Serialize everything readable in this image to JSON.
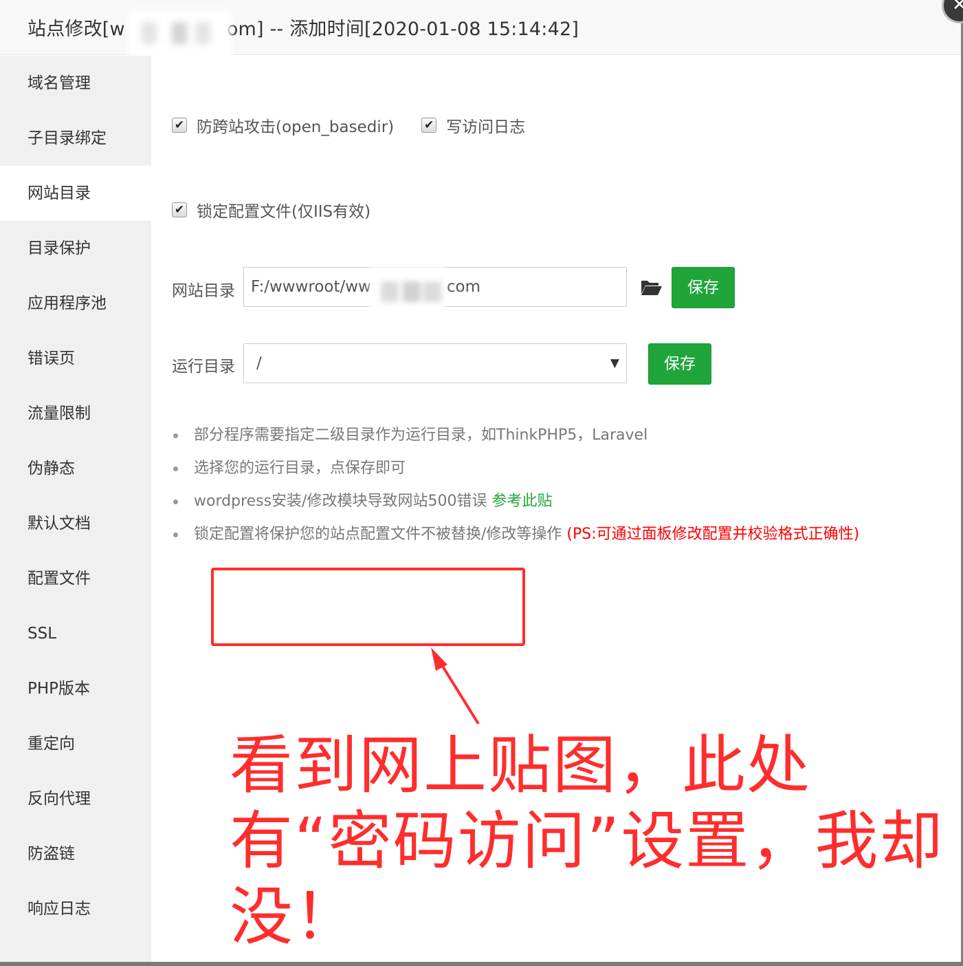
{
  "dialog": {
    "title_prefix": "站点修改[w",
    "title_suffix": "om] -- 添加时间[2020-01-08 15:14:42]",
    "close_icon": "close-icon"
  },
  "sidebar": {
    "items": [
      {
        "label": "域名管理"
      },
      {
        "label": "子目录绑定"
      },
      {
        "label": "网站目录"
      },
      {
        "label": "目录保护"
      },
      {
        "label": "应用程序池"
      },
      {
        "label": "错误页"
      },
      {
        "label": "流量限制"
      },
      {
        "label": "伪静态"
      },
      {
        "label": "默认文档"
      },
      {
        "label": "配置文件"
      },
      {
        "label": "SSL"
      },
      {
        "label": "PHP版本"
      },
      {
        "label": "重定向"
      },
      {
        "label": "反向代理"
      },
      {
        "label": "防盗链"
      },
      {
        "label": "响应日志"
      }
    ],
    "active_label": "网站目录"
  },
  "options": {
    "anti_xss": {
      "label": "防跨站攻击(open_basedir)",
      "checked": true
    },
    "access_log": {
      "label": "写访问日志",
      "checked": true
    },
    "lock_config": {
      "label": "锁定配置文件(仅IIS有效)",
      "checked": true
    }
  },
  "site_dir": {
    "label": "网站目录",
    "value_prefix": "F:/wwwroot/ww",
    "value_suffix": "com",
    "save_label": "保存",
    "folder_icon": "folder-open-icon"
  },
  "run_dir": {
    "label": "运行目录",
    "value": "/",
    "arrow": "▼",
    "save_label": "保存"
  },
  "notes": {
    "n1": "部分程序需要指定二级目录作为运行目录，如ThinkPHP5，Laravel",
    "n2": "选择您的运行目录，点保存即可",
    "n3_text": "wordpress安装/修改模块导致网站500错误 ",
    "n3_link": "参考此贴",
    "n4_text": "锁定配置将保护您的站点配置文件不被替换/修改等操作 ",
    "n4_red": "(PS:可通过面板修改配置并校验格式正确性)"
  },
  "annotation": {
    "text": "看到网上贴图，此处有“密码访问”设置，我却没！",
    "color": "#ff2d2d"
  },
  "colors": {
    "accent_green": "#20a53a",
    "sidebar_bg": "#f0f0f0",
    "annotation_red": "#ff2d2d"
  }
}
